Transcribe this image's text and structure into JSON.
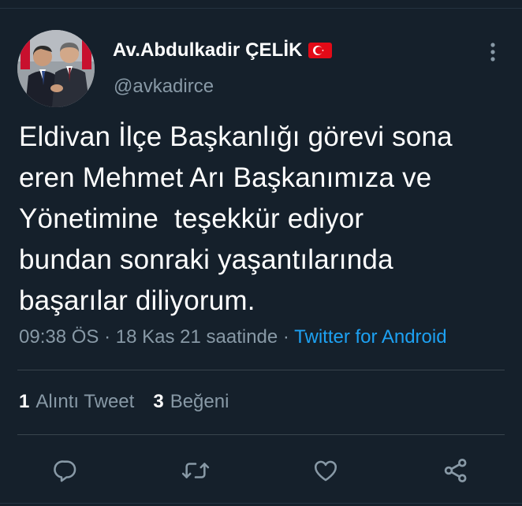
{
  "author": {
    "display_name": "Av.Abdulkadir ÇELİK",
    "handle": "@avkadirce",
    "avatar_icon": "profile-photo",
    "flag_icon": "turkey-flag"
  },
  "tweet": {
    "text": "Eldivan İlçe Başkanlığı görevi sona\neren Mehmet Arı Başkanımıza ve\nYönetimine  teşekkür ediyor\nbundan sonraki yaşantılarında\nbaşarılar diliyorum.",
    "time": "09:38 ÖS",
    "separator": "·",
    "date": "18 Kas 21 saatinde",
    "source": "Twitter for Android"
  },
  "stats": {
    "quote_count": "1",
    "quote_label": "Alıntı Tweet",
    "like_count": "3",
    "like_label": "Beğeni"
  },
  "actions": {
    "reply_icon": "reply-icon",
    "retweet_icon": "retweet-icon",
    "like_icon": "heart-icon",
    "share_icon": "share-icon",
    "more_icon": "more-vertical-icon"
  },
  "colors": {
    "background": "#15202b",
    "text": "#ffffff",
    "secondary": "#8899a6",
    "accent": "#1da1f2",
    "divider": "#38444d"
  }
}
